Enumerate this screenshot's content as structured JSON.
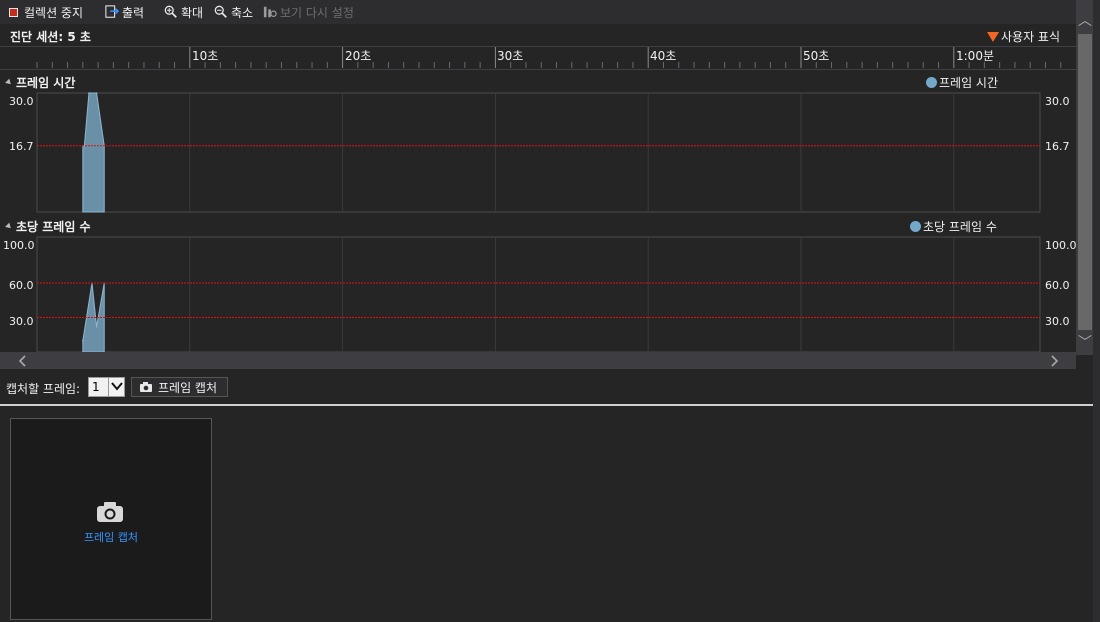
{
  "toolbar": {
    "stop": "컬렉션 중지",
    "export": "출력",
    "zoom_in": "확대",
    "zoom_out": "축소",
    "reset_view": "보기 다시 설정"
  },
  "session": {
    "label": "진단 세션: 5 초",
    "user_marks": "사용자 표식"
  },
  "ruler": {
    "ticks": [
      "10초",
      "20초",
      "30초",
      "40초",
      "50초",
      "1:00분"
    ]
  },
  "frame_time": {
    "title": "프레임 시간",
    "legend": "프레임 시간",
    "y_labels": [
      "30.0",
      "16.7"
    ]
  },
  "fps": {
    "title": "초당 프레임 수",
    "legend": "초당 프레임 수",
    "y_labels": [
      "100.0",
      "60.0",
      "30.0"
    ]
  },
  "capture": {
    "frames_label": "캡처할 프레임:",
    "frames_value": "1",
    "button": "프레임 캡처",
    "tile_label": "프레임 캡처"
  },
  "colors": {
    "series_fill": "#6a90a8",
    "series_legend": "#75a9c9",
    "threshold_line": "#e01010",
    "user_mark": "#f26522"
  },
  "chart_data": [
    {
      "type": "area",
      "x_unit": "초",
      "x": [
        3.0,
        3.1,
        3.4,
        3.9,
        4.4
      ],
      "values": [
        16.7,
        16.7,
        30.0,
        30.0,
        16.7
      ],
      "threshold": 16.7,
      "ylim": [
        0,
        30
      ],
      "xlim": [
        0,
        65
      ],
      "y_ticks": [
        30.0,
        16.7
      ],
      "grid": true
    },
    {
      "type": "area",
      "x_unit": "초",
      "x": [
        3.0,
        3.6,
        3.9,
        4.4
      ],
      "values": [
        10,
        60,
        22,
        60
      ],
      "thresholds": [
        60,
        30
      ],
      "ylim": [
        0,
        100
      ],
      "xlim": [
        0,
        65
      ],
      "y_ticks": [
        100.0,
        60.0,
        30.0
      ],
      "grid": true
    }
  ]
}
